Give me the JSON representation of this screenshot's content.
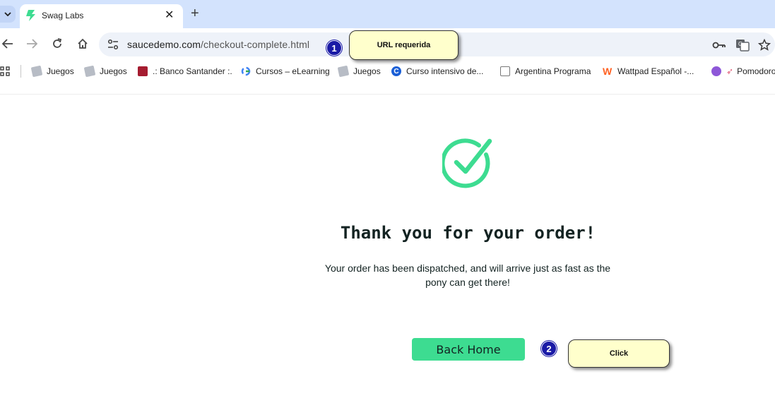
{
  "browser": {
    "tab": {
      "title": "Swag Labs"
    },
    "address_bar": {
      "url_host": "saucedemo.com",
      "url_path": "/checkout-complete.html"
    },
    "bookmarks": [
      {
        "label": "Juegos",
        "icon": "gamepad-icon"
      },
      {
        "label": "Juegos",
        "icon": "gamepad-icon"
      },
      {
        "label": ".: Banco Santander :.",
        "icon": "bank-icon"
      },
      {
        "label": "Cursos – eLearning",
        "icon": "google-icon"
      },
      {
        "label": "Juegos",
        "icon": "gamepad-icon"
      },
      {
        "label": "Curso intensivo de...",
        "icon": "course-icon"
      },
      {
        "label": "Argentina Programa",
        "icon": "terminal-icon"
      },
      {
        "label": "Wattpad Español -...",
        "icon": "wattpad-icon"
      },
      {
        "label": "Pomodoro",
        "icon": "timer-icon"
      }
    ]
  },
  "page": {
    "heading": "Thank you for your order!",
    "message": "Your order has been dispatched, and will arrive just as fast as the pony can get there!",
    "back_button": "Back Home",
    "accent_color": "#3ddc91"
  },
  "annotations": [
    {
      "number": "1",
      "note": "URL requerida"
    },
    {
      "number": "2",
      "note": "Click"
    }
  ]
}
